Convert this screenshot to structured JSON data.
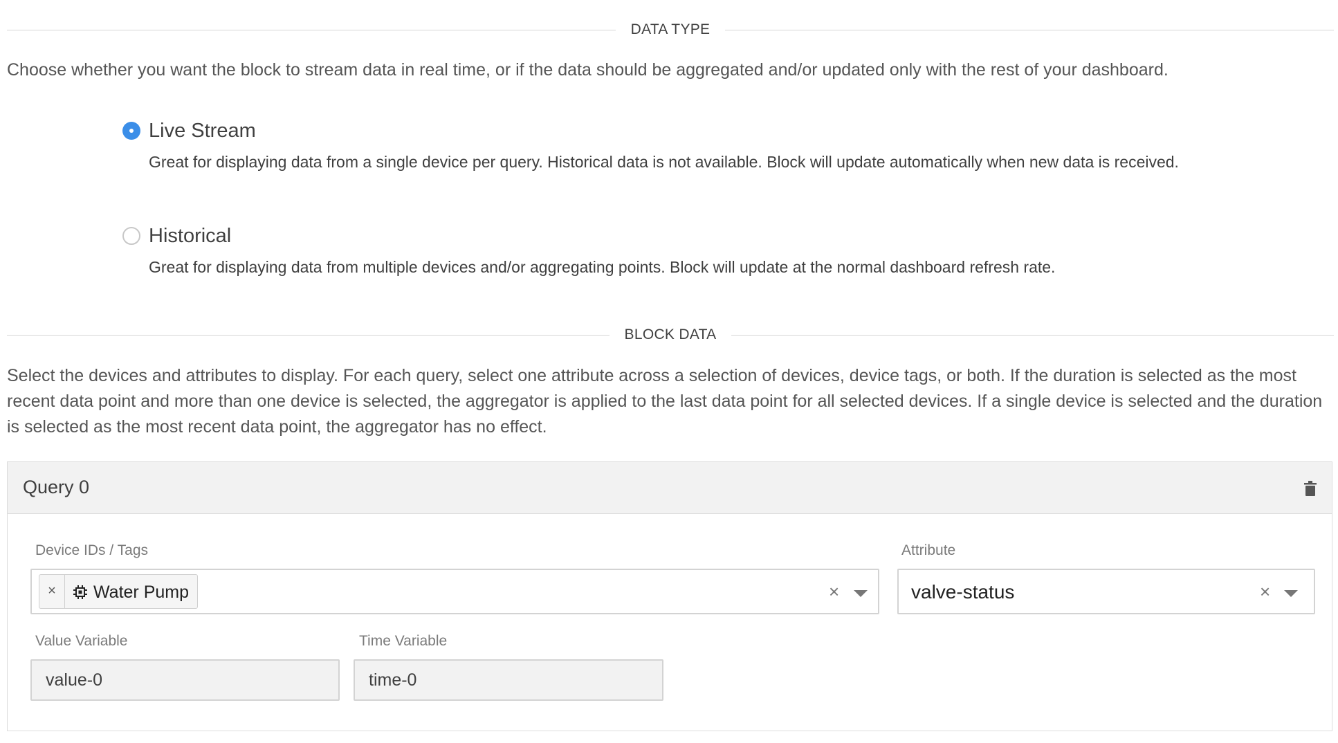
{
  "data_type": {
    "section_title": "DATA TYPE",
    "intro": "Choose whether you want the block to stream data in real time, or if the data should be aggregated and/or updated only with the rest of your dashboard.",
    "options": [
      {
        "label": "Live Stream",
        "description": "Great for displaying data from a single device per query. Historical data is not available. Block will update automatically when new data is received.",
        "selected": true
      },
      {
        "label": "Historical",
        "description": "Great for displaying data from multiple devices and/or aggregating points. Block will update at the normal dashboard refresh rate.",
        "selected": false
      }
    ]
  },
  "block_data": {
    "section_title": "BLOCK DATA",
    "intro": "Select the devices and attributes to display. For each query, select one attribute across a selection of devices, device tags, or both. If the duration is selected as the most recent data point and more than one device is selected, the aggregator is applied to the last data point for all selected devices. If a single device is selected and the duration is selected as the most recent data point, the aggregator has no effect."
  },
  "query": {
    "title": "Query 0",
    "delete_icon": "trash-icon",
    "device_ids_label": "Device IDs / Tags",
    "device_tags": [
      {
        "remove_symbol": "×",
        "icon": "chip-icon",
        "label": "Water Pump"
      }
    ],
    "attribute_label": "Attribute",
    "attribute_value": "valve-status",
    "clear_symbol": "×",
    "value_variable_label": "Value Variable",
    "value_variable": "value-0",
    "time_variable_label": "Time Variable",
    "time_variable": "time-0"
  },
  "colors": {
    "accent": "#3b8ee8",
    "panel_header": "#f2f2f2",
    "border": "#d3d3d3"
  }
}
